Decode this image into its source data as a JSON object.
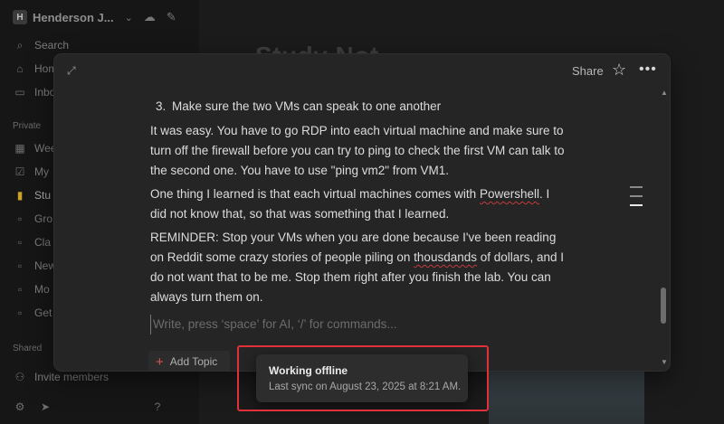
{
  "workspace": {
    "initial": "H",
    "name": "Henderson J..."
  },
  "sidebar": {
    "items_top": [
      {
        "label": "Search",
        "icon": "search-icon"
      },
      {
        "label": "Hom",
        "icon": "home-icon"
      },
      {
        "label": "Inbo",
        "icon": "inbox-icon"
      }
    ],
    "private_label": "Private",
    "items_private": [
      {
        "label": "Wee",
        "icon": "calendar-icon"
      },
      {
        "label": "My",
        "icon": "check-icon"
      },
      {
        "label": "Stu",
        "icon": "notebook-icon"
      },
      {
        "label": "Gro",
        "icon": "page-icon"
      },
      {
        "label": "Cla",
        "icon": "page-icon"
      },
      {
        "label": "New",
        "icon": "page-icon"
      },
      {
        "label": "Mo",
        "icon": "page-icon"
      },
      {
        "label": "Get",
        "icon": "page-icon"
      }
    ],
    "shared_label": "Shared",
    "invite_label": "Invite members"
  },
  "background_title": "Study Not",
  "modal": {
    "share_label": "Share",
    "list_number": "3.",
    "list_text": "Make sure the two VMs can speak to one another",
    "para1": "It was easy. You have to go RDP into each virtual machine and make sure to turn off the firewall before you can try to ping to check the first VM can talk to the second one. You have to use \"ping vm2\" from VM1.",
    "para2_a": "One thing I learned is that each virtual machines comes with ",
    "para2_b": "Powershell",
    "para2_c": ". I did not know that, so that was something that I learned.",
    "para3_a": "REMINDER: Stop your VMs when you are done because I've been reading on Reddit some crazy stories of people piling on ",
    "para3_b": "thousdands",
    "para3_c": " of dollars, and I do not want that to be me. Stop them right after you finish the lab. You can always turn them on.",
    "placeholder": "Write, press ‘space’ for AI, ‘/’ for commands...",
    "add_topic_label": "Add Topic"
  },
  "toast": {
    "title": "Working offline",
    "subtitle": "Last sync on August 23, 2025 at 8:21 AM."
  },
  "colors": {
    "highlight": "#e0303a",
    "spell_error": "#c23b3b",
    "add_topic_plus": "#d9534f"
  }
}
